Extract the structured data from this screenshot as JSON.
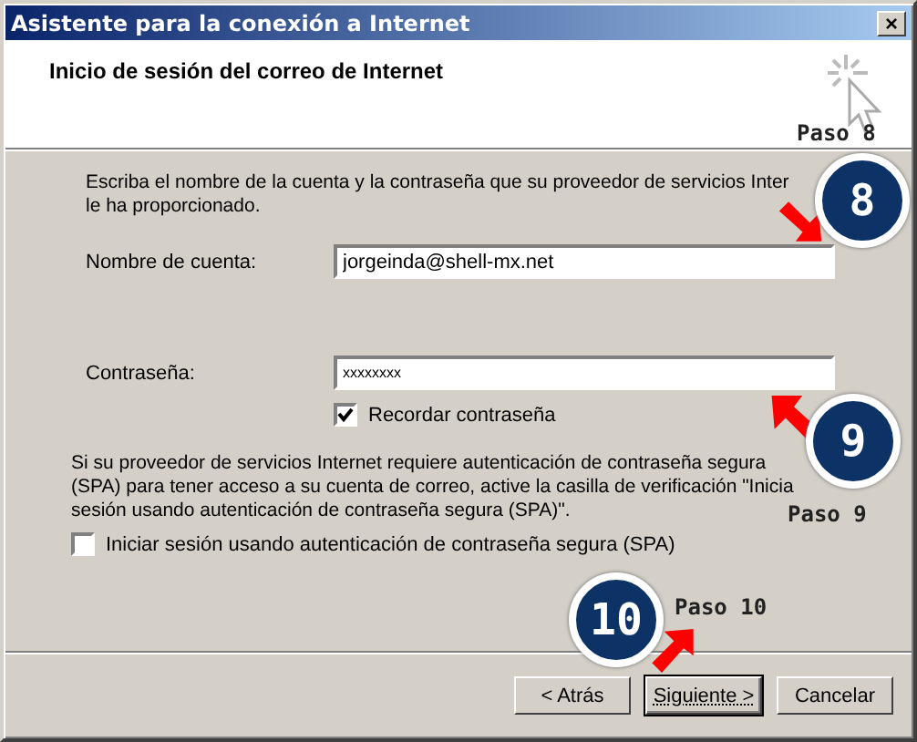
{
  "window": {
    "title": "Asistente para la conexión a Internet",
    "close": "×"
  },
  "header": {
    "title": "Inicio de sesión del correo de Internet"
  },
  "intro_lines": [
    "Escriba el nombre de la cuenta y la contraseña que su proveedor de servicios Inter",
    "le ha proporcionado."
  ],
  "account": {
    "label": "Nombre de cuenta:",
    "value": "jorgeinda@shell-mx.net"
  },
  "password": {
    "label": "Contraseña:",
    "value": "xxxxxxxx"
  },
  "remember": {
    "label": "Recordar contraseña",
    "checked": true
  },
  "spa_lines": [
    "Si su proveedor de servicios Internet requiere autenticación de contraseña segura",
    "(SPA) para tener acceso a su cuenta de correo, active la casilla de verificación \"Inicia",
    "sesión usando autenticación de contraseña segura (SPA)\"."
  ],
  "spa": {
    "label": "Iniciar sesión usando autenticación de contraseña segura (SPA)",
    "checked": false
  },
  "buttons": [
    {
      "label": "< Atrás",
      "default": false
    },
    {
      "label": "Siguiente >",
      "default": true
    },
    {
      "label": "Cancelar",
      "default": false
    }
  ],
  "annotations": [
    {
      "number": "8",
      "step": "Paso 8"
    },
    {
      "number": "9",
      "step": "Paso 9"
    },
    {
      "number": "10",
      "step": "Paso 10"
    }
  ]
}
